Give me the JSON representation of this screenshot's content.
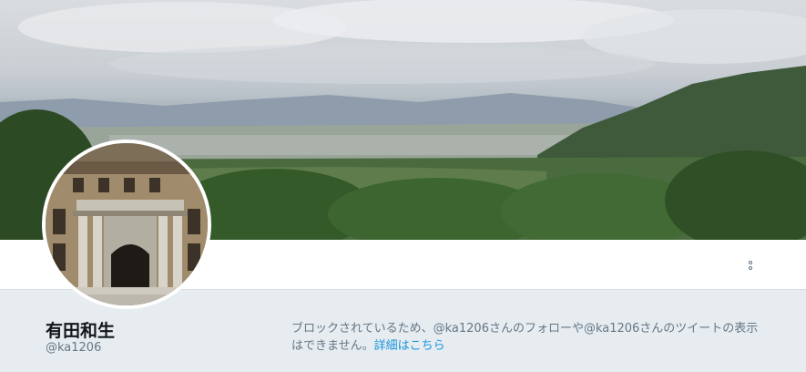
{
  "profile": {
    "name": "有田和生",
    "handle": "@ka1206"
  },
  "banner": {
    "description_icon": "landscape-photo"
  },
  "header": {
    "more_icon": "more-options-icon"
  },
  "notice": {
    "text": "ブロックされているため、@ka1206さんのフォローや@ka1206さんのツイートの表示はできません。",
    "link_label": "詳細はこちら"
  },
  "colors": {
    "background": "#e6ecf0",
    "name": "#14171a",
    "secondary_text": "#657786",
    "link": "#1b95e0"
  }
}
